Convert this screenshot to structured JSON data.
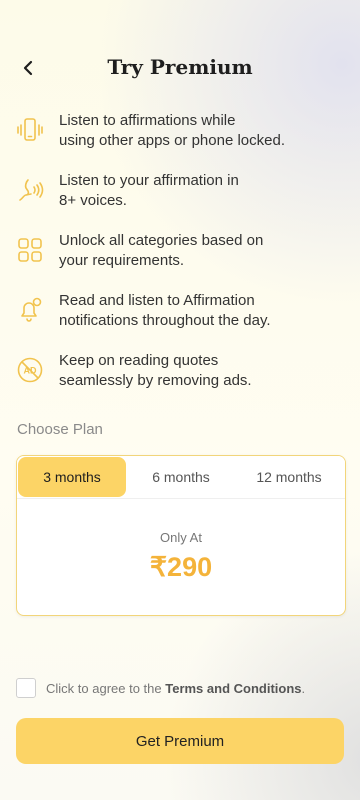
{
  "header": {
    "title": "Try Premium",
    "back_icon": "chevron-left-icon"
  },
  "features": [
    {
      "icon": "phone-vibrate-icon",
      "line1": "Listen to affirmations while",
      "line2": "using other apps or phone locked."
    },
    {
      "icon": "voice-icon",
      "line1": "Listen to your affirmation in",
      "line2": "8+ voices."
    },
    {
      "icon": "grid-icon",
      "line1": "Unlock all categories based on",
      "line2": "your requirements."
    },
    {
      "icon": "bell-notification-icon",
      "line1": "Read and listen to Affirmation",
      "line2": "notifications throughout the day."
    },
    {
      "icon": "no-ads-icon",
      "line1": "Keep on reading quotes",
      "line2": "seamlessly by removing ads."
    }
  ],
  "plan": {
    "label": "Choose Plan",
    "tabs": [
      "3 months",
      "6 months",
      "12 months"
    ],
    "selected": "3 months",
    "price_caption": "Only At",
    "price": "₹290"
  },
  "agreement": {
    "prefix": "Click to agree to the ",
    "link": "Terms and Conditions",
    "suffix": ".",
    "checked": false
  },
  "cta": {
    "label": "Get Premium"
  },
  "colors": {
    "accent": "#fcd466",
    "price": "#f4b33a",
    "icon": "#f1c34e"
  }
}
